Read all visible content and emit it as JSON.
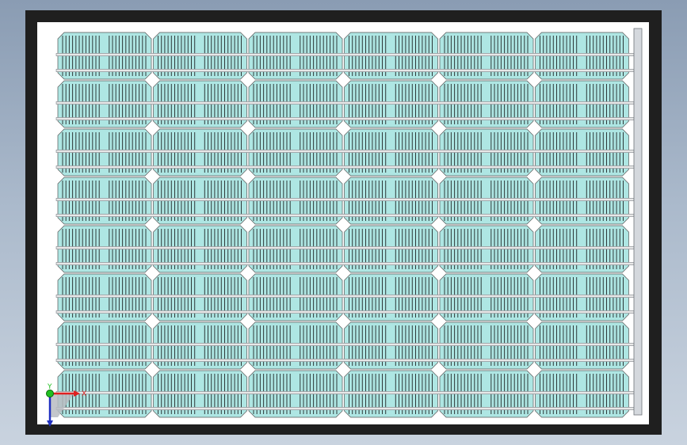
{
  "viewport": {
    "background_top": "#8a9cb3",
    "background_bottom": "#c9d3df"
  },
  "panel": {
    "frame_color": "#1f1f1f",
    "backsheet_color": "#ffffff",
    "cell_color": "#aee6e3",
    "cell_outline": "#555555",
    "finger_color": "#2f3a3a",
    "busbar_color": "#e8e8e8",
    "junction_bar_color": "#d4d8dd",
    "columns": 6,
    "rows": 8
  },
  "triad": {
    "x_label": "X",
    "y_label": "Y",
    "x_color": "#e02020",
    "y_color": "#20c020",
    "z_color": "#2030c0"
  }
}
